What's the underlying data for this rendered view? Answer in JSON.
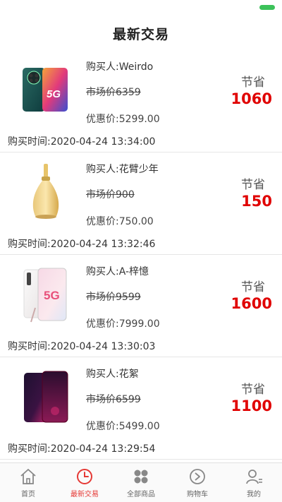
{
  "header": {
    "title": "最新交易"
  },
  "colors": {
    "accent": "#e53935",
    "saving": "#e00000",
    "status_green": "#3cc25a"
  },
  "transactions": [
    {
      "buyer": "购买人:Weirdo",
      "market": "市场价6359",
      "price": "优惠价:5299.00",
      "save_label": "节省",
      "save_amount": "1060",
      "time": "购买时间:2020-04-24 13:34:00",
      "icon": "phone-mate30-icon"
    },
    {
      "buyer": "购买人:花臂少年",
      "market": "市场价900",
      "price": "优惠价:750.00",
      "save_label": "节省",
      "save_amount": "150",
      "time": "购买时间:2020-04-24 13:32:46",
      "icon": "perfume-icon"
    },
    {
      "buyer": "购买人:A-梓憶",
      "market": "市场价9599",
      "price": "优惠价:7999.00",
      "save_label": "节省",
      "save_amount": "1600",
      "time": "购买时间:2020-04-24 13:30:03",
      "icon": "phone-5g-icon"
    },
    {
      "buyer": "购买人:花絮",
      "market": "市场价6599",
      "price": "优惠价:5499.00",
      "save_label": "节省",
      "save_amount": "1100",
      "time": "购买时间:2020-04-24 13:29:54",
      "icon": "phone-findx-icon"
    }
  ],
  "tabbar": {
    "items": [
      {
        "label": "首页",
        "icon": "home-icon"
      },
      {
        "label": "最新交易",
        "icon": "clock-icon",
        "active": true
      },
      {
        "label": "全部商品",
        "icon": "grid-icon"
      },
      {
        "label": "购物车",
        "icon": "cart-icon"
      },
      {
        "label": "我的",
        "icon": "user-icon"
      }
    ]
  }
}
